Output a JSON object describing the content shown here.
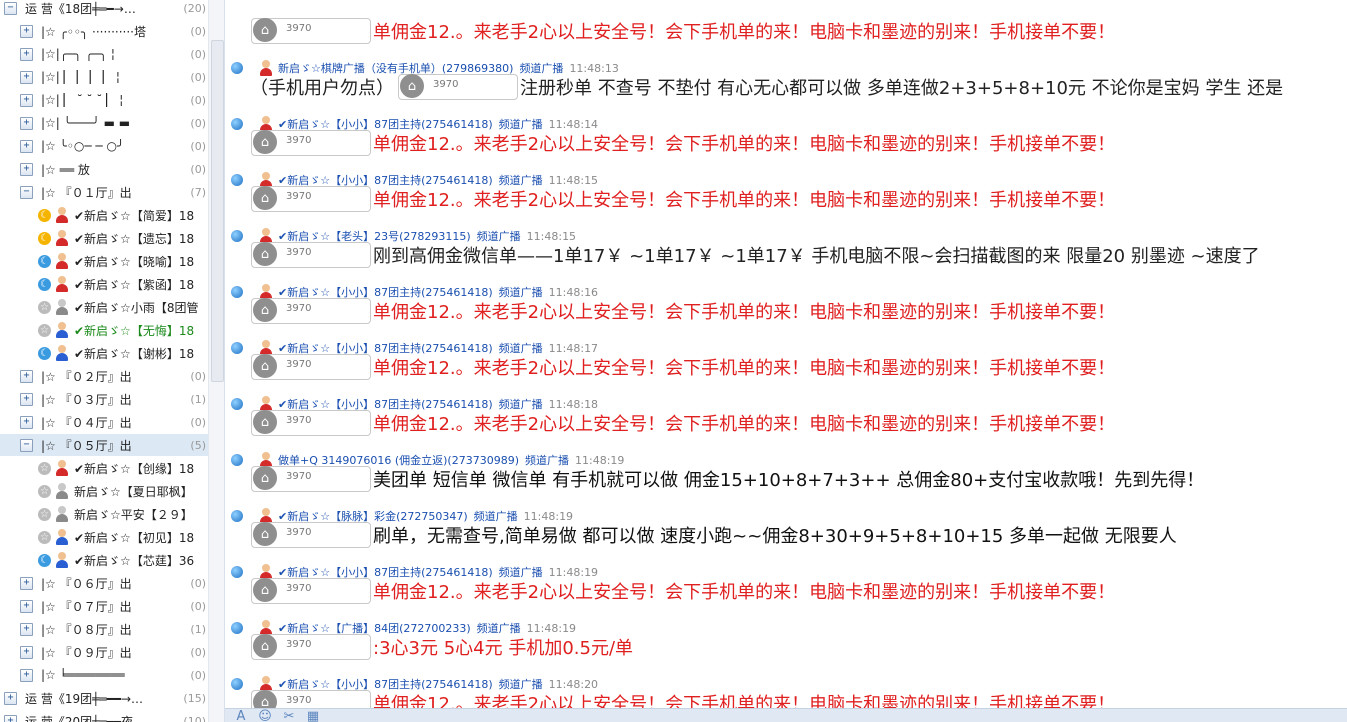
{
  "sidebar": {
    "groups": [
      {
        "label": "运  营《18团╪═━→…",
        "count": "(20)",
        "toggle": "−",
        "indent": 0
      },
      {
        "label": "|☆ ╭◦◦╮ ···········塔",
        "count": "(0)",
        "toggle": "+",
        "indent": 1
      },
      {
        "label": "|☆|╭─╮   ╭─╮ ¦",
        "count": "(0)",
        "toggle": "+",
        "indent": 1
      },
      {
        "label": "|☆| ▏ ▏ ▏ ▏ ¦",
        "count": "(0)",
        "toggle": "+",
        "indent": 1
      },
      {
        "label": "|☆| ▏ ˘ ˘  ˘  ▏ ¦",
        "count": "(0)",
        "toggle": "+",
        "indent": 1
      },
      {
        "label": "|☆| ╰───╯ ▬ ▬",
        "count": "(0)",
        "toggle": "+",
        "indent": 1
      },
      {
        "label": "|☆  ╰◦○─ ─ ○╯",
        "count": "(0)",
        "toggle": "+",
        "indent": 1
      },
      {
        "label": "|☆    ══    放",
        "count": "(0)",
        "toggle": "+",
        "indent": 1
      },
      {
        "label": "|☆ 『０１厅』出",
        "count": "(7)",
        "toggle": "−",
        "indent": 1
      }
    ],
    "members_01": [
      {
        "status": "moon",
        "avatar": "red",
        "label": "✔新启ゞ☆【简爱】18"
      },
      {
        "status": "moon",
        "avatar": "red",
        "label": "✔新启ゞ☆【遗忘】18"
      },
      {
        "status": "online",
        "avatar": "red",
        "label": "✔新启ゞ☆【晓喻】18"
      },
      {
        "status": "online",
        "avatar": "red",
        "label": "✔新启ゞ☆【紫函】18"
      },
      {
        "status": "away",
        "avatar": "gray",
        "label": "✔新启ゞ☆小雨【8团管"
      },
      {
        "status": "away",
        "avatar": "blue",
        "label": "✔新启ゞ☆【无悔】18"
      },
      {
        "status": "online",
        "avatar": "blue",
        "label": "✔新启ゞ☆【谢彬】18"
      }
    ],
    "groups2": [
      {
        "label": "|☆ 『０２厅』出",
        "count": "(0)",
        "toggle": "+"
      },
      {
        "label": "|☆ 『０３厅』出",
        "count": "(1)",
        "toggle": "+"
      },
      {
        "label": "|☆ 『０４厅』出",
        "count": "(0)",
        "toggle": "+"
      },
      {
        "label": "|☆ 『０５厅』出",
        "count": "(5)",
        "toggle": "−"
      }
    ],
    "members_05": [
      {
        "status": "away",
        "avatar": "red",
        "label": "✔新启ゞ☆【创缘】18"
      },
      {
        "status": "away",
        "avatar": "gray",
        "label": "新启ゞ☆【夏日耶枫】"
      },
      {
        "status": "away",
        "avatar": "gray",
        "label": "新启ゞ☆平安【２９】"
      },
      {
        "status": "away",
        "avatar": "blue",
        "label": "✔新启ゞ☆【初见】18"
      },
      {
        "status": "online",
        "avatar": "blue",
        "label": "✔新启ゞ☆【芯莛】36"
      }
    ],
    "groups3": [
      {
        "label": "|☆ 『０６厅』出",
        "count": "(0)",
        "toggle": "+",
        "indent": 1
      },
      {
        "label": "|☆ 『０７厅』出",
        "count": "(0)",
        "toggle": "+",
        "indent": 1
      },
      {
        "label": "|☆ 『０８厅』出",
        "count": "(1)",
        "toggle": "+",
        "indent": 1
      },
      {
        "label": "|☆ 『０９厅』出",
        "count": "(0)",
        "toggle": "+",
        "indent": 1
      },
      {
        "label": "|☆ ╘════════",
        "count": "(0)",
        "toggle": "+",
        "indent": 1
      },
      {
        "label": "运  营《19团╪═━━→…",
        "count": "(15)",
        "toggle": "+",
        "indent": 0
      },
      {
        "label": "运  营《20团╪═━━夜…",
        "count": "(10)",
        "toggle": "+",
        "indent": 0
      }
    ]
  },
  "chat": {
    "messages": [
      {
        "header": null,
        "bubble": "3970",
        "pre": "",
        "text": "单佣金12.。来老手2心以上安全号！会下手机单的来！电脑卡和墨迹的别来！手机接单不要！",
        "style": "red"
      },
      {
        "header": {
          "sender": "新启ゞ☆棋牌广播（没有手机单）(279869380)",
          "channel": "频道广播",
          "time": "11:48:13"
        },
        "bubble": "3970",
        "pre": "（手机用户勿点）",
        "text": "注册秒单 不查号 不垫付 有心无心都可以做 多单连做2+3+5+8+10元 不论你是宝妈 学生 还是",
        "style": "dark"
      },
      {
        "header": {
          "sender": "✔新启ゞ☆【小小】87团主持(275461418)",
          "channel": "频道广播",
          "time": "11:48:14"
        },
        "bubble": "3970",
        "pre": "",
        "text": "单佣金12.。来老手2心以上安全号！会下手机单的来！电脑卡和墨迹的别来！手机接单不要！",
        "style": "red"
      },
      {
        "header": {
          "sender": "✔新启ゞ☆【小小】87团主持(275461418)",
          "channel": "频道广播",
          "time": "11:48:15"
        },
        "bubble": "3970",
        "pre": "",
        "text": "单佣金12.。来老手2心以上安全号！会下手机单的来！电脑卡和墨迹的别来！手机接单不要！",
        "style": "red"
      },
      {
        "header": {
          "sender": "✔新启ゞ☆【老头】23号(278293115)",
          "channel": "频道广播",
          "time": "11:48:15"
        },
        "bubble": "3970",
        "pre": "",
        "text": "刚到高佣金微信单——1单17￥ ~1单17￥ ~1单17￥ 手机电脑不限~会扫描截图的来 限量20 别墨迹 ~速度了",
        "style": "dark"
      },
      {
        "header": {
          "sender": "✔新启ゞ☆【小小】87团主持(275461418)",
          "channel": "频道广播",
          "time": "11:48:16"
        },
        "bubble": "3970",
        "pre": "",
        "text": "单佣金12.。来老手2心以上安全号！会下手机单的来！电脑卡和墨迹的别来！手机接单不要！",
        "style": "red"
      },
      {
        "header": {
          "sender": "✔新启ゞ☆【小小】87团主持(275461418)",
          "channel": "频道广播",
          "time": "11:48:17"
        },
        "bubble": "3970",
        "pre": "",
        "text": "单佣金12.。来老手2心以上安全号！会下手机单的来！电脑卡和墨迹的别来！手机接单不要！",
        "style": "red"
      },
      {
        "header": {
          "sender": "✔新启ゞ☆【小小】87团主持(275461418)",
          "channel": "频道广播",
          "time": "11:48:18"
        },
        "bubble": "3970",
        "pre": "",
        "text": "单佣金12.。来老手2心以上安全号！会下手机单的来！电脑卡和墨迹的别来！手机接单不要！",
        "style": "red"
      },
      {
        "header": {
          "sender": "做单+Q  3149076016 (佣金立返)(273730989)",
          "channel": "频道广播",
          "time": "11:48:19"
        },
        "bubble": "3970",
        "pre": "",
        "text": "美团单 短信单 微信单 有手机就可以做  佣金15+10+8+7+3++  总佣金80+支付宝收款哦！先到先得！",
        "style": "black"
      },
      {
        "header": {
          "sender": "✔新启ゞ☆【脉脉】彩金(272750347)",
          "channel": "频道广播",
          "time": "11:48:19"
        },
        "bubble": "3970",
        "pre": "",
        "text": "刷单，无需查号,简单易做   都可以做 速度小跑~~佣金8+30+9+5+8+10+15   多单一起做   无限要人",
        "style": "black"
      },
      {
        "header": {
          "sender": "✔新启ゞ☆【小小】87团主持(275461418)",
          "channel": "频道广播",
          "time": "11:48:19"
        },
        "bubble": "3970",
        "pre": "",
        "text": "单佣金12.。来老手2心以上安全号！会下手机单的来！电脑卡和墨迹的别来！手机接单不要！",
        "style": "red"
      },
      {
        "header": {
          "sender": "✔新启ゞ☆【广播】84团(272700233)",
          "channel": "频道广播",
          "time": "11:48:19"
        },
        "bubble": "3970",
        "pre": "",
        "text": ":3心3元  5心4元  手机加0.5元/单",
        "style": "red"
      },
      {
        "header": {
          "sender": "✔新启ゞ☆【小小】87团主持(275461418)",
          "channel": "频道广播",
          "time": "11:48:20"
        },
        "bubble": "3970",
        "pre": "",
        "text": "单佣金12.。来老手2心以上安全号！会下手机单的来！电脑卡和墨迹的别来！手机接单不要！",
        "style": "red"
      }
    ]
  },
  "toolbar": {
    "icons": [
      "font-icon",
      "emoji-icon",
      "scissors-icon",
      "image-icon"
    ],
    "glyphs": [
      "A",
      "☺",
      "✂",
      "▦"
    ]
  },
  "colors": {
    "red_text": "#e02020",
    "sender_blue": "#1a4fb0",
    "selected_bg": "#dde8f5"
  }
}
